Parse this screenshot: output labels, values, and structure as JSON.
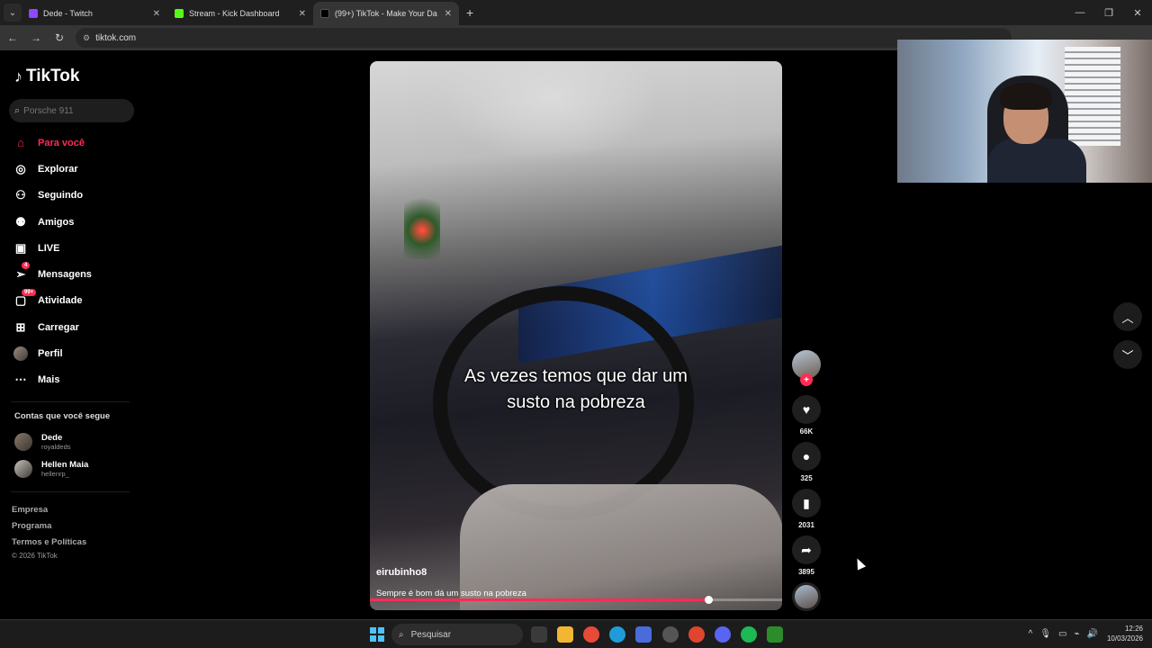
{
  "browser": {
    "tabs": [
      {
        "title": "Dede - Twitch",
        "favicon_color": "#9146ff"
      },
      {
        "title": "Stream - Kick Dashboard",
        "favicon_color": "#53fc18"
      },
      {
        "title": "(99+) TikTok - Make Your Da",
        "favicon_color": "#000000"
      }
    ],
    "url": "tiktok.com"
  },
  "tiktok": {
    "logo": "TikTok",
    "search_placeholder": "Porsche 911",
    "nav": [
      {
        "label": "Para você",
        "icon": "home-icon",
        "active": true
      },
      {
        "label": "Explorar",
        "icon": "compass-icon"
      },
      {
        "label": "Seguindo",
        "icon": "following-icon"
      },
      {
        "label": "Amigos",
        "icon": "friends-icon"
      },
      {
        "label": "LIVE",
        "icon": "live-icon"
      },
      {
        "label": "Mensagens",
        "icon": "messages-icon",
        "badge": "4"
      },
      {
        "label": "Atividade",
        "icon": "activity-icon",
        "badge": "99+"
      },
      {
        "label": "Carregar",
        "icon": "upload-icon"
      },
      {
        "label": "Perfil",
        "icon": "profile-avatar-icon"
      },
      {
        "label": "Mais",
        "icon": "more-icon"
      }
    ],
    "following_title": "Contas que você segue",
    "following": [
      {
        "name": "Dede",
        "handle": "royaldeds"
      },
      {
        "name": "Hellen Maia",
        "handle": "hellenrp_"
      }
    ],
    "footer": [
      "Empresa",
      "Programa",
      "Termos e Políticas"
    ],
    "copyright": "© 2026 TikTok"
  },
  "video": {
    "caption_line1": "As vezes temos que dar um",
    "caption_line2": "susto na pobreza",
    "author": "eirubinho8",
    "description": "Sempre é bom dá um susto na pobreza",
    "progress": 0.82,
    "likes": "66K",
    "comments": "325",
    "saves": "2031",
    "shares": "3895"
  },
  "taskbar": {
    "search_label": "Pesquisar",
    "time": "12:26",
    "date": "10/03/2026"
  }
}
